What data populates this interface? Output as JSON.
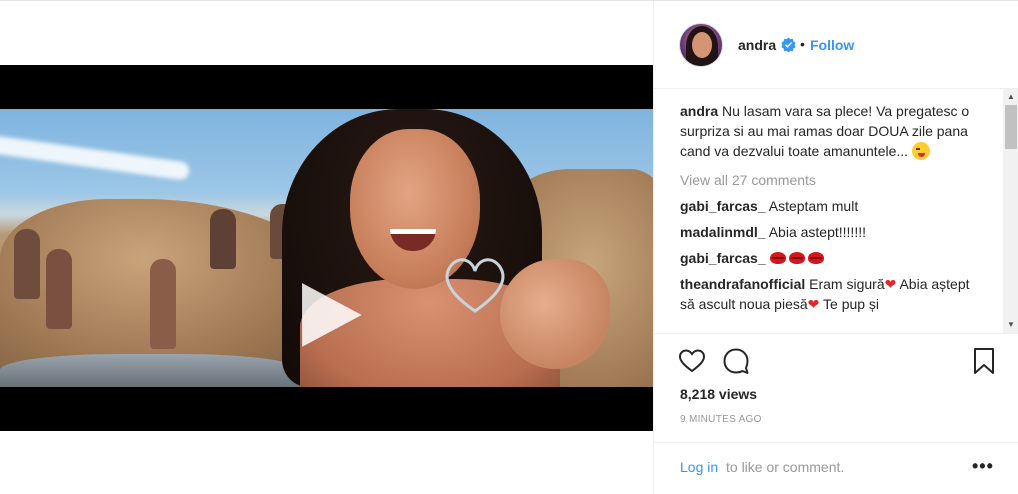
{
  "post": {
    "username": "andra",
    "follow_label": "Follow",
    "separator": "•",
    "caption_user": "andra",
    "caption_text": " Nu lasam vara sa plece! Va pregatesc o surpriza si au mai ramas doar DOUA zile pana cand va dezvalui toate amanuntele...",
    "view_all": "View all 27 comments",
    "views": "8,218 views",
    "timestamp": "9 MINUTES AGO"
  },
  "comments": [
    {
      "user": "gabi_farcas_",
      "text": " Asteptam mult"
    },
    {
      "user": "madalinmdl_",
      "text": " Abia astept!!!!!!!"
    },
    {
      "user": "gabi_farcas_",
      "text": " "
    },
    {
      "user": "theandrafanofficial",
      "text_a": " Eram sigură",
      "text_b": " Abia aștept să ascult noua piesă",
      "text_c": " Te pup și"
    }
  ],
  "footer": {
    "login_label": "Log in",
    "login_rest": " to like or comment.",
    "more_label": "•••"
  },
  "icons": {
    "play": "play-icon",
    "verified": "verified-badge-icon",
    "like": "heart-icon",
    "comment": "comment-bubble-icon",
    "save": "bookmark-icon",
    "more": "ellipsis-icon"
  },
  "colors": {
    "link": "#3897f0",
    "muted": "#999999",
    "text": "#262626",
    "border": "#efefef"
  }
}
